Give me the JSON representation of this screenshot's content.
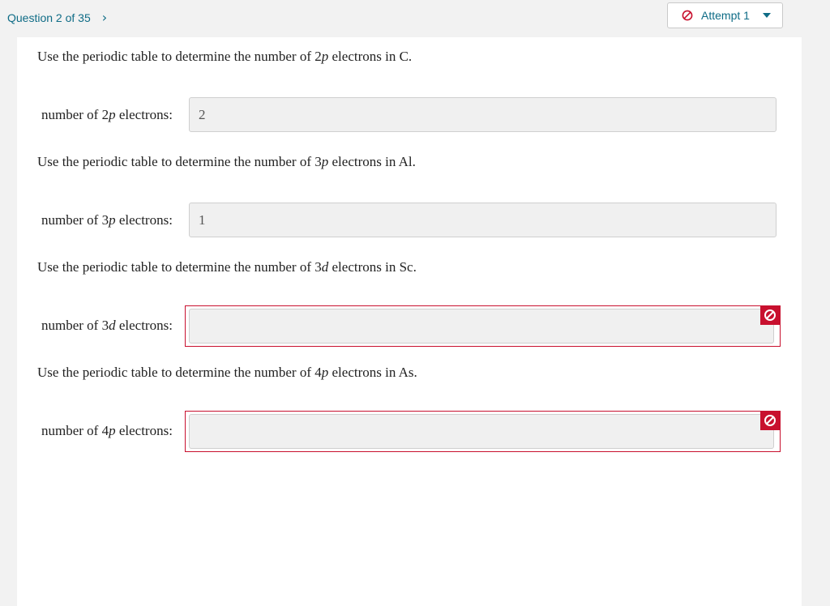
{
  "header": {
    "question_progress": "Question 2 of 35",
    "next_icon": "chevron-right-icon",
    "attempt_label": "Attempt 1",
    "attempt_status_icon": "no-entry-icon",
    "dropdown_icon": "caret-down-icon"
  },
  "colors": {
    "accent": "#0f6c86",
    "error": "#c8102e",
    "page_bg": "#f2f2f2",
    "input_bg": "#f0f0f0"
  },
  "questions": [
    {
      "prompt_before": "Use the periodic table to determine the number of 2",
      "orbital": "p",
      "prompt_after": " electrons in C.",
      "label_before": "number of 2",
      "label_orbital": "p",
      "label_after": " electrons:",
      "value": "2",
      "status": "answered"
    },
    {
      "prompt_before": "Use the periodic table to determine the number of 3",
      "orbital": "p",
      "prompt_after": " electrons in Al.",
      "label_before": "number of 3",
      "label_orbital": "p",
      "label_after": " electrons:",
      "value": "1",
      "status": "answered"
    },
    {
      "prompt_before": "Use the periodic table to determine the number of 3",
      "orbital": "d",
      "prompt_after": " electrons in Sc.",
      "label_before": "number of 3",
      "label_orbital": "d",
      "label_after": " electrons:",
      "value": "",
      "status": "incorrect"
    },
    {
      "prompt_before": "Use the periodic table to determine the number of 4",
      "orbital": "p",
      "prompt_after": " electrons in As.",
      "label_before": "number of 4",
      "label_orbital": "p",
      "label_after": " electrons:",
      "value": "",
      "status": "incorrect"
    }
  ]
}
